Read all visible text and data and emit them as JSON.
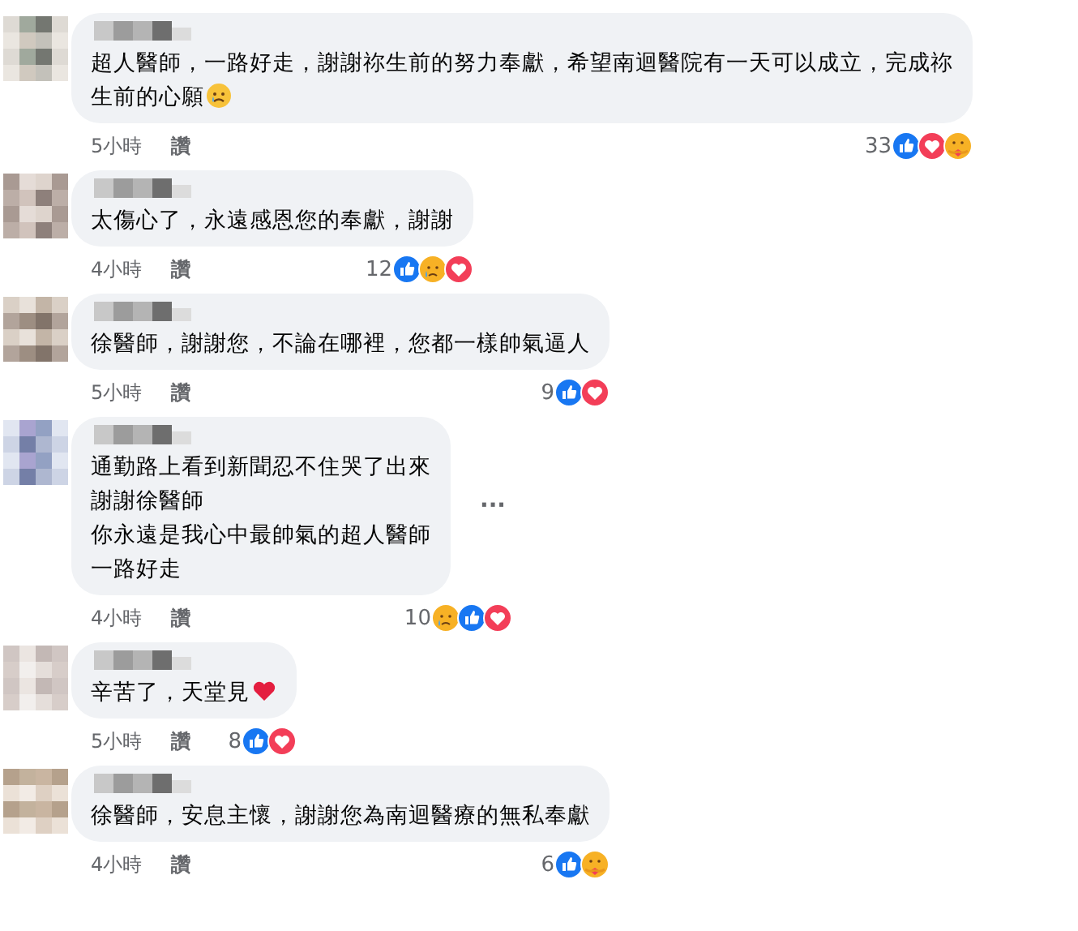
{
  "comments": [
    {
      "lines": [
        "超人醫師，一路好走，謝謝祢生前的努力奉獻，希望南迴醫院有一天可以成立，完成祢",
        "生前的心願"
      ],
      "trailing_emoji": {
        "kind": "sad"
      },
      "time": "5小時",
      "like_label": "讚",
      "reaction_count": "33",
      "reactions": [
        {
          "kind": "like"
        },
        {
          "kind": "love"
        },
        {
          "kind": "care"
        }
      ]
    },
    {
      "lines": [
        "太傷心了，永遠感恩您的奉獻，謝謝"
      ],
      "time": "4小時",
      "like_label": "讚",
      "reaction_count": "12",
      "reactions": [
        {
          "kind": "like"
        },
        {
          "kind": "sad"
        },
        {
          "kind": "love"
        }
      ]
    },
    {
      "lines": [
        "徐醫師，謝謝您，不論在哪裡，您都一樣帥氣逼人"
      ],
      "time": "5小時",
      "like_label": "讚",
      "reaction_count": "9",
      "reactions": [
        {
          "kind": "like"
        },
        {
          "kind": "love"
        }
      ]
    },
    {
      "lines": [
        "通勤路上看到新聞忍不住哭了出來",
        "謝謝徐醫師",
        "你永遠是我心中最帥氣的超人醫師",
        "一路好走"
      ],
      "more_label": "···",
      "time": "4小時",
      "like_label": "讚",
      "reaction_count": "10",
      "reactions": [
        {
          "kind": "sad"
        },
        {
          "kind": "like"
        },
        {
          "kind": "love"
        }
      ]
    },
    {
      "lines": [
        "辛苦了，天堂見"
      ],
      "trailing_emoji": {
        "kind": "heart"
      },
      "time": "5小時",
      "like_label": "讚",
      "reaction_count": "8",
      "reactions": [
        {
          "kind": "like"
        },
        {
          "kind": "love"
        }
      ]
    },
    {
      "lines": [
        "徐醫師，安息主懷，謝謝您為南迴醫療的無私奉獻"
      ],
      "time": "4小時",
      "like_label": "讚",
      "reaction_count": "6",
      "reactions": [
        {
          "kind": "like"
        },
        {
          "kind": "care"
        }
      ]
    }
  ]
}
